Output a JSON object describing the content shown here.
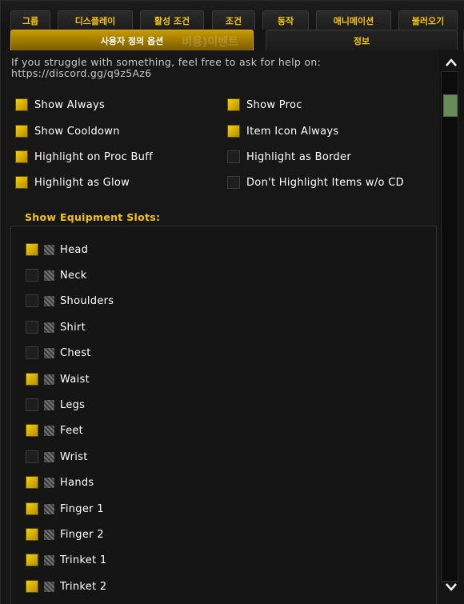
{
  "tabs_row1": [
    {
      "label": "그룹"
    },
    {
      "label": "디스플레이"
    },
    {
      "label": "활성 조건"
    },
    {
      "label": "조건"
    },
    {
      "label": "동작"
    },
    {
      "label": "애니메이션"
    },
    {
      "label": "불러오기"
    }
  ],
  "tabs_row2": [
    {
      "label": "사용자 정의 옵션",
      "ghost": "비용)이벤트",
      "active": true
    },
    {
      "label": "정보",
      "active": false
    }
  ],
  "help_text": "If you struggle with something, feel free to ask for help on: https://discord.gg/q9z5Az6",
  "options": [
    {
      "label": "Show Always",
      "checked": true
    },
    {
      "label": "Show Proc",
      "checked": true
    },
    {
      "label": "Show Cooldown",
      "checked": true
    },
    {
      "label": "Item Icon Always",
      "checked": true
    },
    {
      "label": "Highlight on Proc Buff",
      "checked": true
    },
    {
      "label": "Highlight as Border",
      "checked": false
    },
    {
      "label": "Highlight as Glow",
      "checked": true
    },
    {
      "label": "Don't Highlight Items w/o CD",
      "checked": false
    }
  ],
  "slots_header": "Show Equipment Slots:",
  "slots": [
    {
      "label": "Head",
      "checked": true
    },
    {
      "label": "Neck",
      "checked": false
    },
    {
      "label": "Shoulders",
      "checked": false
    },
    {
      "label": "Shirt",
      "checked": false
    },
    {
      "label": "Chest",
      "checked": false
    },
    {
      "label": "Waist",
      "checked": true
    },
    {
      "label": "Legs",
      "checked": false
    },
    {
      "label": "Feet",
      "checked": true
    },
    {
      "label": "Wrist",
      "checked": false
    },
    {
      "label": "Hands",
      "checked": true
    },
    {
      "label": "Finger 1",
      "checked": true
    },
    {
      "label": "Finger 2",
      "checked": true
    },
    {
      "label": "Trinket 1",
      "checked": true
    },
    {
      "label": "Trinket 2",
      "checked": true
    }
  ],
  "scrollbar": {
    "up_icon": "chevron-up-icon",
    "down_icon": "chevron-down-icon"
  },
  "colors": {
    "accent": "#f5c400",
    "active_tab": "#c79a00",
    "checked": "#e6bf00",
    "thumb": "#6a8a5a"
  }
}
